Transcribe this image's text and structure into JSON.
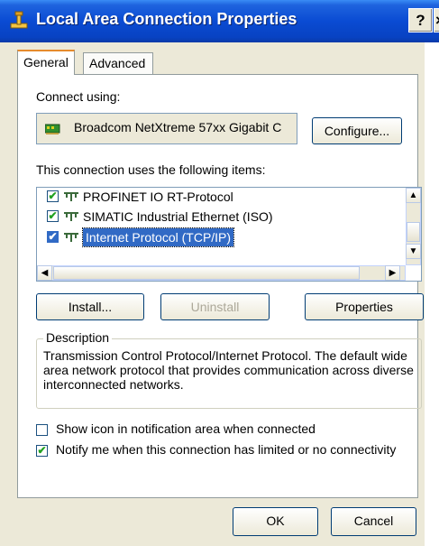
{
  "window": {
    "title": "Local Area Connection Properties",
    "help_label": "?",
    "close_label": "×"
  },
  "tabs": [
    {
      "label": "General",
      "selected": true
    },
    {
      "label": "Advanced",
      "selected": false
    }
  ],
  "connect_using": {
    "label": "Connect using:",
    "adapter": "Broadcom NetXtreme 57xx Gigabit C",
    "configure_label": "Configure..."
  },
  "items": {
    "label": "This connection uses the following items:",
    "list": [
      {
        "label": "PROFINET IO RT-Protocol",
        "checked": true
      },
      {
        "label": "SIMATIC Industrial Ethernet (ISO)",
        "checked": true
      },
      {
        "label": "Internet Protocol (TCP/IP)",
        "checked": true,
        "selected": true
      }
    ]
  },
  "actions": {
    "install_label": "Install...",
    "uninstall_label": "Uninstall",
    "properties_label": "Properties"
  },
  "description": {
    "title": "Description",
    "text": "Transmission Control Protocol/Internet Protocol. The default wide area network protocol that provides communication across diverse interconnected networks."
  },
  "options": {
    "show_icon_label": "Show icon in notification area when connected",
    "show_icon_checked": false,
    "notify_label": "Notify me when this connection has limited or no connectivity",
    "notify_checked": true
  },
  "footer": {
    "ok_label": "OK",
    "cancel_label": "Cancel"
  },
  "glyphs": {
    "check": "✔",
    "arrow_up": "▲",
    "arrow_down": "▼",
    "arrow_left": "◀",
    "arrow_right": "▶"
  },
  "colors": {
    "selection": "#316ac5",
    "titlebar": "#0a4bd3"
  }
}
